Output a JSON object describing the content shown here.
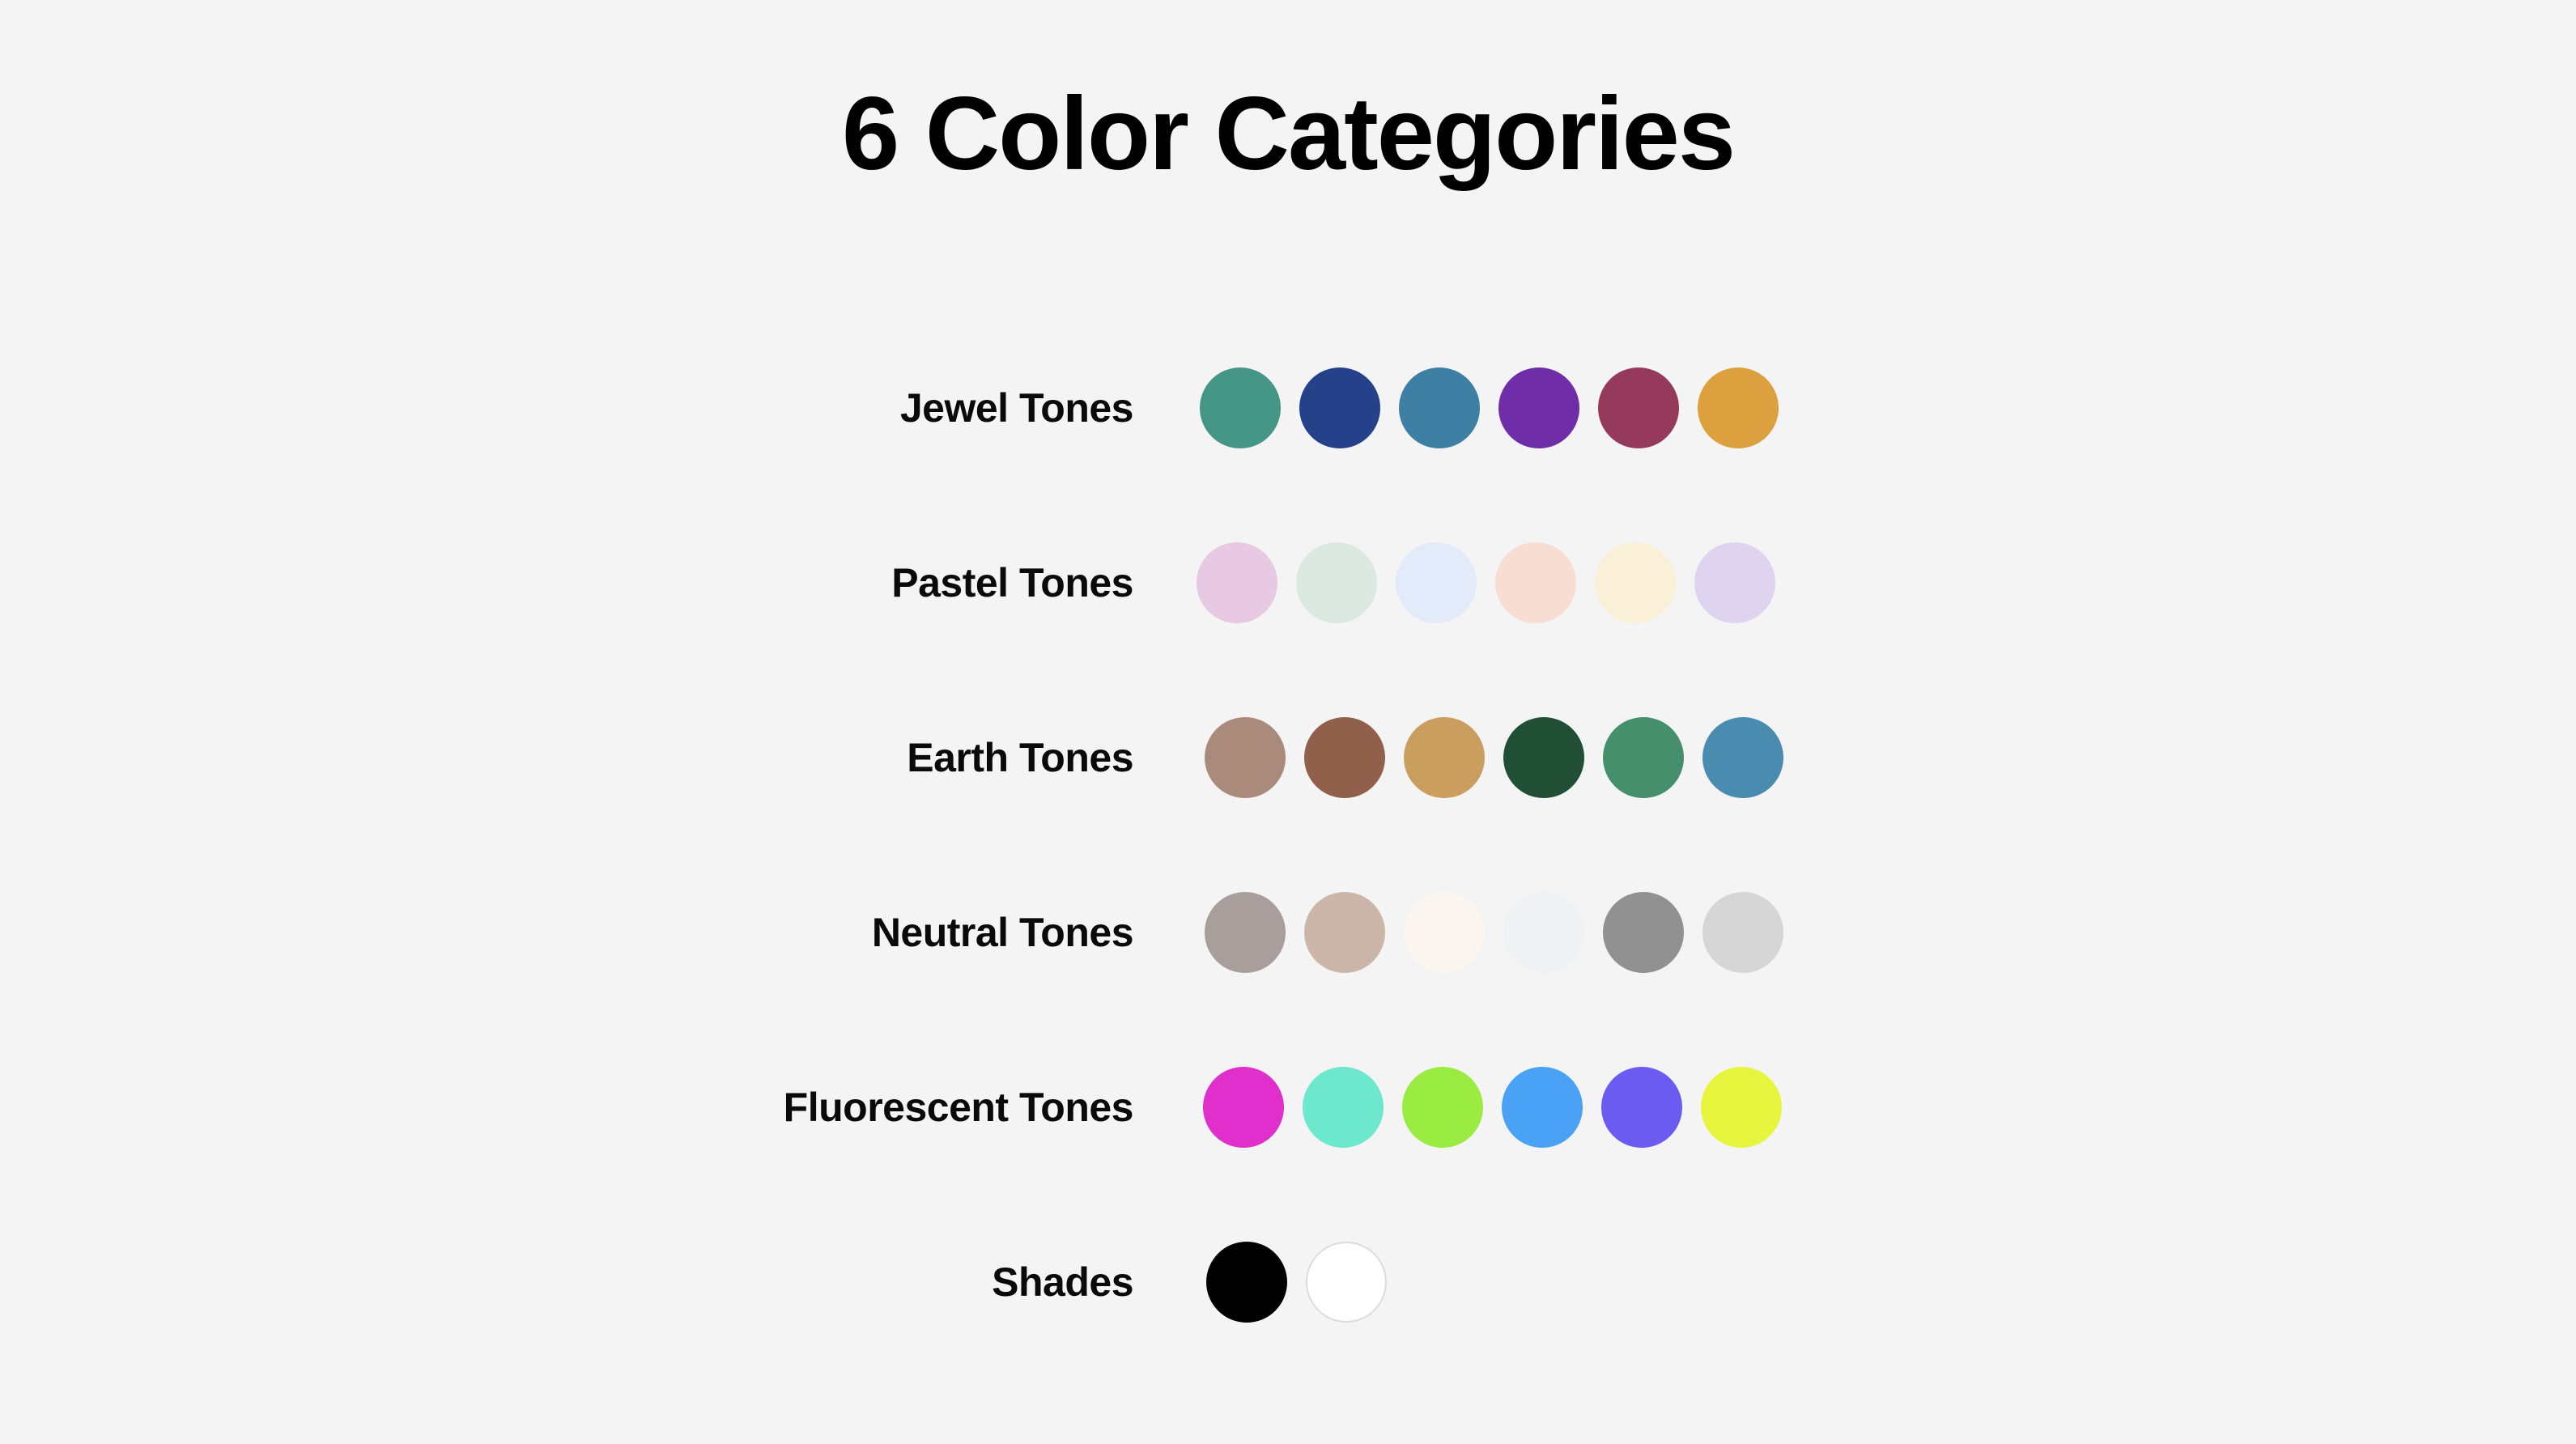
{
  "page": {
    "title": "6 Color Categories",
    "background_color": "#f4f4f4",
    "title_color": "#000000",
    "label_color": "#0a0a0a"
  },
  "chart_data": {
    "type": "table",
    "title": "6 Color Categories",
    "xlabel": "",
    "ylabel": "",
    "categories": [
      "Jewel Tones",
      "Pastel Tones",
      "Earth Tones",
      "Neutral Tones",
      "Fluorescent Tones",
      "Shades"
    ],
    "values": [
      6,
      6,
      6,
      6,
      6,
      2
    ],
    "series": [
      {
        "name": "Jewel Tones",
        "swatch_count": 6,
        "colors": [
          "#469688",
          "#254189",
          "#3d80a4",
          "#6f2da8",
          "#963a5c",
          "#dda03e"
        ]
      },
      {
        "name": "Pastel Tones",
        "swatch_count": 6,
        "colors": [
          "#e7c9e3",
          "#dce9e2",
          "#e3eafa",
          "#f8ded2",
          "#faf0d8",
          "#dfd4ef"
        ]
      },
      {
        "name": "Earth Tones",
        "swatch_count": 6,
        "colors": [
          "#a98a7b",
          "#90604a",
          "#c99e5e",
          "#204f35",
          "#458f6d",
          "#4a8cb0"
        ]
      },
      {
        "name": "Neutral Tones",
        "swatch_count": 6,
        "colors": [
          "#a89e9b",
          "#ccb5a9",
          "#fbf7f0",
          "#eff1f3",
          "#919191",
          "#d6d6d6"
        ]
      },
      {
        "name": "Fluorescent Tones",
        "swatch_count": 6,
        "colors": [
          "#e02fcc",
          "#6de8ce",
          "#9aec42",
          "#4aa2f7",
          "#6b5bf0",
          "#e8f53f"
        ]
      },
      {
        "name": "Shades",
        "swatch_count": 2,
        "colors": [
          "#000000",
          "#ffffff"
        ]
      }
    ],
    "legend_position": "none",
    "grid": false
  },
  "rows": [
    {
      "label": "Jewel Tones",
      "offset_left": 1482,
      "swatches": [
        {
          "name": "jewel-teal",
          "color": "#469688",
          "outlined": false
        },
        {
          "name": "jewel-navy",
          "color": "#254189",
          "outlined": false
        },
        {
          "name": "jewel-steel-blue",
          "color": "#3d80a4",
          "outlined": false
        },
        {
          "name": "jewel-purple",
          "color": "#6f2da8",
          "outlined": false
        },
        {
          "name": "jewel-maroon",
          "color": "#963a5c",
          "outlined": false
        },
        {
          "name": "jewel-gold",
          "color": "#dda03e",
          "outlined": false
        }
      ]
    },
    {
      "label": "Pastel Tones",
      "offset_left": 1478,
      "swatches": [
        {
          "name": "pastel-pink",
          "color": "#e7c9e3",
          "outlined": false
        },
        {
          "name": "pastel-mint",
          "color": "#dce9e2",
          "outlined": false
        },
        {
          "name": "pastel-powder-blue",
          "color": "#e3eafa",
          "outlined": false
        },
        {
          "name": "pastel-peach",
          "color": "#f8ded2",
          "outlined": false
        },
        {
          "name": "pastel-cream",
          "color": "#faf0d8",
          "outlined": false
        },
        {
          "name": "pastel-lavender",
          "color": "#dfd4ef",
          "outlined": false
        }
      ]
    },
    {
      "label": "Earth Tones",
      "offset_left": 1488,
      "swatches": [
        {
          "name": "earth-taupe",
          "color": "#a98a7b",
          "outlined": false
        },
        {
          "name": "earth-terracotta",
          "color": "#90604a",
          "outlined": false
        },
        {
          "name": "earth-sand",
          "color": "#c99e5e",
          "outlined": false
        },
        {
          "name": "earth-forest-green",
          "color": "#204f35",
          "outlined": false
        },
        {
          "name": "earth-sea-green",
          "color": "#458f6d",
          "outlined": false
        },
        {
          "name": "earth-slate-blue",
          "color": "#4a8cb0",
          "outlined": false
        }
      ]
    },
    {
      "label": "Neutral Tones",
      "offset_left": 1488,
      "swatches": [
        {
          "name": "neutral-warm-gray",
          "color": "#a89e9b",
          "outlined": false
        },
        {
          "name": "neutral-beige",
          "color": "#ccb5a9",
          "outlined": false
        },
        {
          "name": "neutral-ivory",
          "color": "#fbf7f0",
          "outlined": false
        },
        {
          "name": "neutral-off-white",
          "color": "#eff1f3",
          "outlined": false
        },
        {
          "name": "neutral-mid-gray",
          "color": "#919191",
          "outlined": false
        },
        {
          "name": "neutral-light-gray",
          "color": "#d6d6d6",
          "outlined": false
        }
      ]
    },
    {
      "label": "Fluorescent Tones",
      "offset_left": 1486,
      "swatches": [
        {
          "name": "fluorescent-magenta",
          "color": "#e02fcc",
          "outlined": false
        },
        {
          "name": "fluorescent-aquamarine",
          "color": "#6de8ce",
          "outlined": false
        },
        {
          "name": "fluorescent-lime",
          "color": "#9aec42",
          "outlined": false
        },
        {
          "name": "fluorescent-azure",
          "color": "#4aa2f7",
          "outlined": false
        },
        {
          "name": "fluorescent-violet",
          "color": "#6b5bf0",
          "outlined": false
        },
        {
          "name": "fluorescent-yellow",
          "color": "#e8f53f",
          "outlined": false
        }
      ]
    },
    {
      "label": "Shades",
      "offset_left": 1490,
      "swatches": [
        {
          "name": "shade-black",
          "color": "#000000",
          "outlined": false
        },
        {
          "name": "shade-white",
          "color": "#ffffff",
          "outlined": true
        }
      ]
    }
  ]
}
